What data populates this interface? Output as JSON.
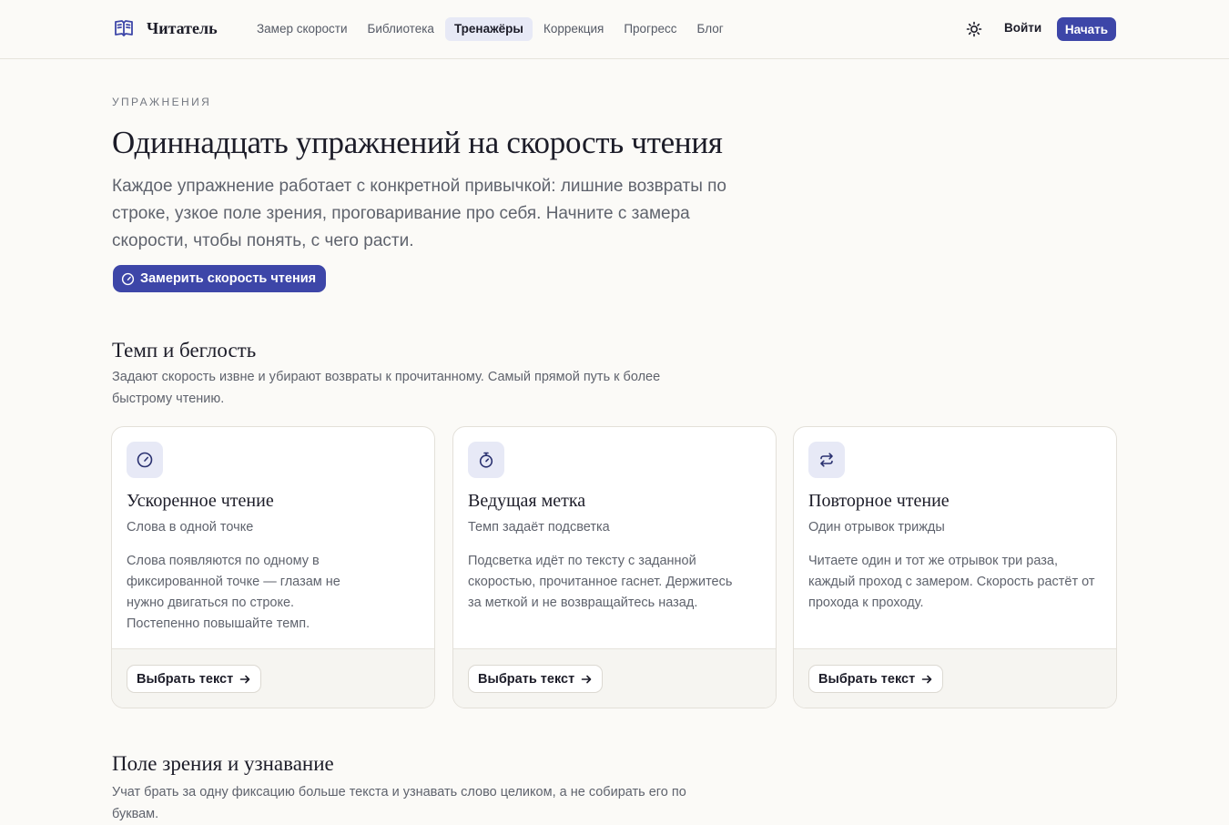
{
  "header": {
    "logo_text": "Читатель",
    "nav": [
      {
        "label": "Замер скорости"
      },
      {
        "label": "Библиотека"
      },
      {
        "label": "Тренажёры",
        "active": true
      },
      {
        "label": "Коррекция"
      },
      {
        "label": "Прогресс"
      },
      {
        "label": "Блог"
      }
    ],
    "login_label": "Войти",
    "start_label": "Начать"
  },
  "hero": {
    "eyebrow": "УПРАЖНЕНИЯ",
    "title": "Одиннадцать упражнений на скорость чтения",
    "lead": "Каждое упражнение работает с конкретной привычкой: лишние возвраты по строке, узкое поле зрения, проговаривание про себя. Начните с замера скорости, чтобы понять, с чего расти.",
    "cta_label": "Замерить скорость чтения"
  },
  "sections": [
    {
      "title": "Темп и беглость",
      "description": "Задают скорость извне и убирают возвраты к прочитанному. Самый прямой путь к более быстрому чтению.",
      "cards": [
        {
          "icon": "gauge-icon",
          "title": "Ускоренное чтение",
          "subtitle": "Слова в одной точке",
          "body": "Слова появляются по одному в фиксированной точке — глазам не нужно двигаться по строке. Постепенно повышайте темп.",
          "button_label": "Выбрать текст"
        },
        {
          "icon": "stopwatch-icon",
          "title": "Ведущая метка",
          "subtitle": "Темп задаёт подсветка",
          "body": "Подсветка идёт по тексту с заданной скоростью, прочитанное гаснет. Держитесь за меткой и не возвращайтесь назад.",
          "button_label": "Выбрать текст"
        },
        {
          "icon": "repeat-icon",
          "title": "Повторное чтение",
          "subtitle": "Один отрывок трижды",
          "body": "Читаете один и тот же отрывок три раза, каждый проход с замером. Скорость растёт от прохода к проходу.",
          "button_label": "Выбрать текст"
        }
      ]
    },
    {
      "title": "Поле зрения и узнавание",
      "description": "Учат брать за одну фиксацию больше текста и узнавать слово целиком, а не собирать его по буквам."
    }
  ],
  "colors": {
    "accent": "#3d46a8",
    "accent_soft": "#e7e9f6",
    "background": "#fbfaf7",
    "text": "#1c1c28",
    "muted": "#5f636d"
  }
}
